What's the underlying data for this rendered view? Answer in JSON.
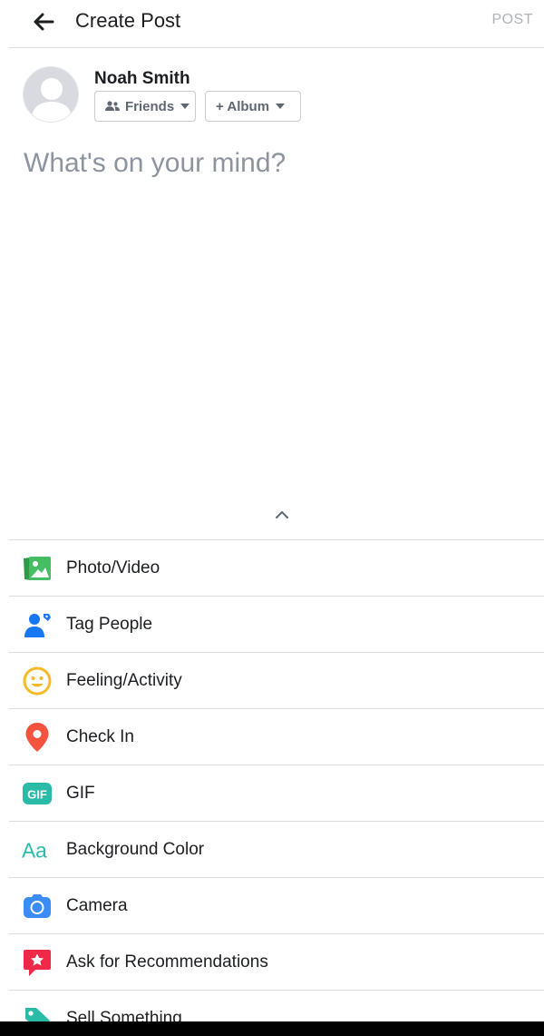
{
  "header": {
    "title": "Create Post",
    "post_label": "POST"
  },
  "user": {
    "name": "Noah Smith"
  },
  "audience": {
    "label": "Friends"
  },
  "album": {
    "label": "+ Album"
  },
  "composer": {
    "placeholder": "What's on your mind?"
  },
  "options": [
    {
      "label": "Photo/Video",
      "icon": "photo-video-icon",
      "color": "#45bd62"
    },
    {
      "label": "Tag People",
      "icon": "tag-people-icon",
      "color": "#1877f2"
    },
    {
      "label": "Feeling/Activity",
      "icon": "feeling-icon",
      "color": "#f7b928"
    },
    {
      "label": "Check In",
      "icon": "check-in-icon",
      "color": "#f5533d"
    },
    {
      "label": "GIF",
      "icon": "gif-icon",
      "color": "#2abba7"
    },
    {
      "label": "Background Color",
      "icon": "background-color-icon",
      "color": "#2abba7"
    },
    {
      "label": "Camera",
      "icon": "camera-icon",
      "color": "#3b8cf5"
    },
    {
      "label": "Ask for Recommendations",
      "icon": "recommendations-icon",
      "color": "#f02849"
    },
    {
      "label": "Sell Something",
      "icon": "sell-icon",
      "color": "#2abba7"
    }
  ]
}
